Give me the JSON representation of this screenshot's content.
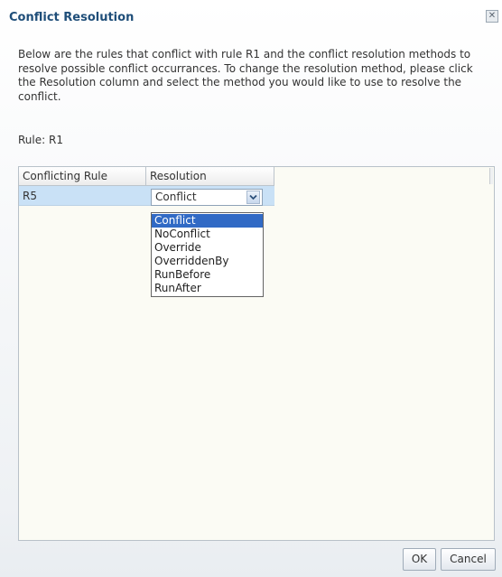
{
  "dialog": {
    "title": "Conflict Resolution",
    "close_icon": "close-icon",
    "description": "Below are the rules that conflict with rule R1 and the conflict resolution methods to resolve possible conflict occurrances. To change the resolution method, please click the Resolution column and select the method you would like to use to resolve the conflict.",
    "rule_label": "Rule: R1"
  },
  "table": {
    "columns": [
      "Conflicting Rule",
      "Resolution"
    ],
    "rows": [
      {
        "rule": "R5",
        "resolution": "Conflict"
      }
    ]
  },
  "dropdown": {
    "options": [
      "Conflict",
      "NoConflict",
      "Override",
      "OverriddenBy",
      "RunBefore",
      "RunAfter"
    ],
    "selected": "Conflict",
    "arrow_icon": "chevron-down-icon"
  },
  "buttons": {
    "ok": "OK",
    "cancel": "Cancel"
  },
  "colors": {
    "title": "#1f4e79",
    "row_highlight": "#c9e1f6",
    "option_selected": "#316ac5",
    "panel_background": "#fbfbf4"
  }
}
